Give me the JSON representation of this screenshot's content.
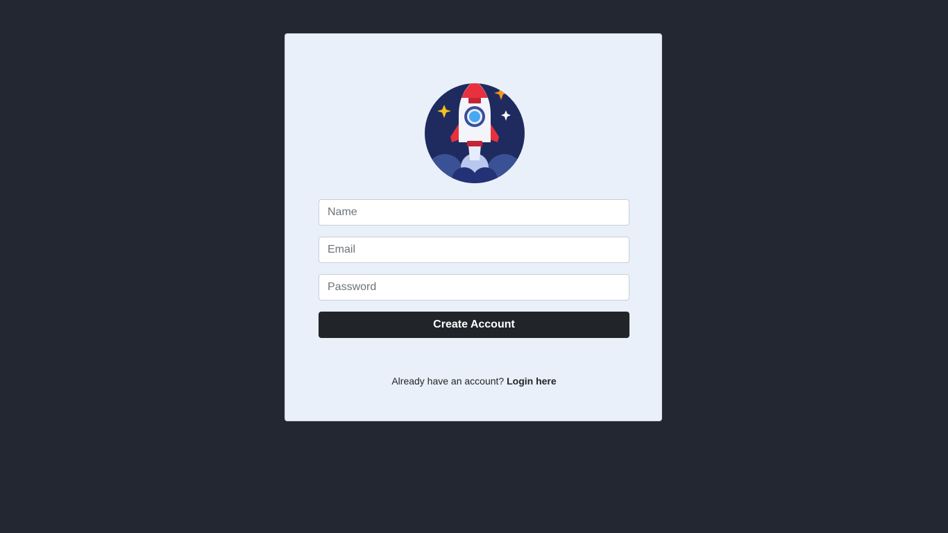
{
  "logo": {
    "icon": "rocket-icon"
  },
  "form": {
    "name_placeholder": "Name",
    "email_placeholder": "Email",
    "password_placeholder": "Password",
    "submit_label": "Create Account"
  },
  "footer": {
    "prompt": "Already have an account?",
    "login_link": "Login here"
  },
  "colors": {
    "page_background": "#222731",
    "card_background": "#e9f0f9",
    "button_background": "#212529",
    "logo_circle": "#1f2b5e",
    "rocket_red": "#e8303f"
  }
}
